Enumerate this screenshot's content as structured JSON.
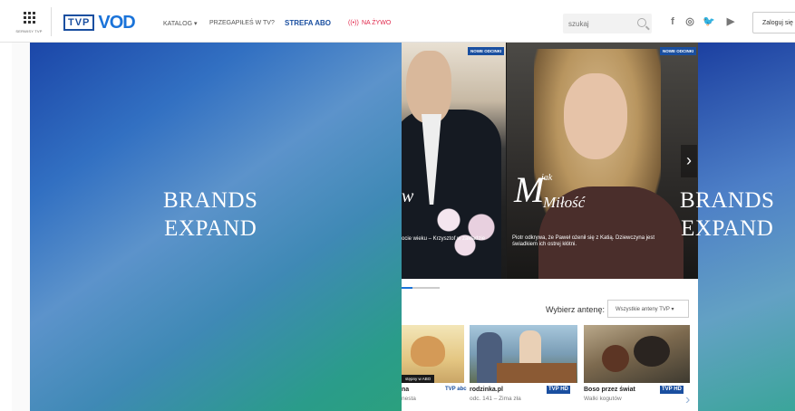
{
  "topbar": {
    "services_label": "SERWISY TVP",
    "logo_tvp": "TVP",
    "logo_vod": "VOD",
    "nav": {
      "katalog": "KATALOG ▾",
      "przegapiles": "PRZEGAPIŁEŚ W TV?",
      "strefa": "STREFA ABO",
      "live_icon": "((•))",
      "live": "NA ŻYWO"
    },
    "search_placeholder": "szukaj",
    "social": {
      "facebook": "f",
      "instagram": "◎",
      "twitter": "🐦",
      "youtube": "▶"
    },
    "login": "Zaloguj się"
  },
  "brands": {
    "left_line1": "BRANDS",
    "left_line2": "EXPAND",
    "right_line1": "BRANDS",
    "right_line2": "EXPAND"
  },
  "hero": {
    "slide1_title": "w",
    "slide1_caption": "ocie wieku – Krzysztof w zakładzie",
    "slide2_badge": "NOWE ODCINKI",
    "slide1_badge": "NOWE ODCINKI",
    "slide2_title_m": "M",
    "slide2_title_jak": "jak",
    "slide2_title_milosc": "Miłość",
    "slide2_caption_line1": "Piotr odkrywa, że Paweł ożenił się z Katią. Dziewczyna jest",
    "slide2_caption_line2": "świadkiem ich ostrej kłótni.",
    "next_arrow": "›"
  },
  "content": {
    "pick_label": "Wybierz antenę:",
    "select_value": "Wszystkie anteny TVP ▾",
    "items": [
      {
        "badge": "stępny w ABO",
        "title": "na",
        "sub": "nesta",
        "channel": "TVP abc"
      },
      {
        "title": "rodzinka.pl",
        "sub": "odc. 141 – Zima zła",
        "channel": "TVP HD"
      },
      {
        "title": "Boso przez świat",
        "sub": "Walki kogutów",
        "channel": "TVP HD"
      }
    ],
    "next_arrow": "›"
  },
  "colors": {
    "accent": "#1a73d9",
    "brand_blue": "#1a4fa0",
    "live_red": "#e0264a"
  }
}
